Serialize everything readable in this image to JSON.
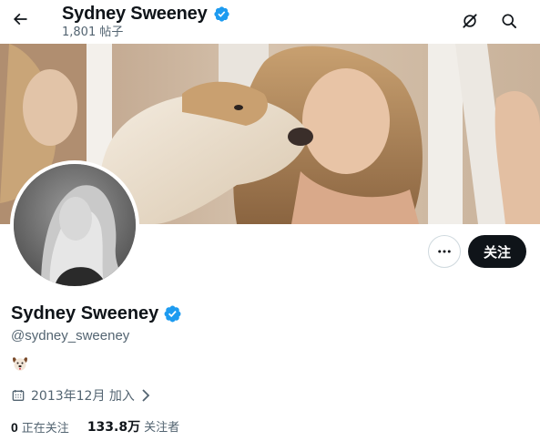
{
  "header": {
    "back_icon": "arrow-left-icon",
    "display_name": "Sydney Sweeney",
    "post_count": "1,801 帖子",
    "grok_icon": "grok-icon",
    "search_icon": "search-icon"
  },
  "profile": {
    "display_name": "Sydney Sweeney",
    "verified_icon": "verified-badge-icon",
    "handle": "@sydney_sweeney",
    "bio_emoji": "dog-face-emoji",
    "joined": "2013年12月 加入",
    "following_count": "0",
    "following_label": "正在关注",
    "followers_count": "133.8万",
    "followers_label": "关注者"
  },
  "actions": {
    "more_icon": "more-horizontal-icon",
    "follow_label": "关注"
  },
  "colors": {
    "verified_blue": "#1d9bf0",
    "text_primary": "#0f1419",
    "text_secondary": "#536471",
    "button_dark": "#0f1419"
  }
}
